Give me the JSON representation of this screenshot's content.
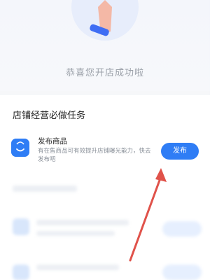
{
  "header": {
    "congrats_text": "恭喜您开店成功啦"
  },
  "section": {
    "title": "店铺经营必做任务"
  },
  "task": {
    "title": "发布商品",
    "description": "有在售商品可有效提升店铺曝光能力，快去发布吧",
    "button_label": "发布"
  },
  "colors": {
    "primary": "#2f7df5",
    "annotation_arrow": "#e0524a"
  },
  "icons": {
    "task_icon": "shopping-bag-icon"
  }
}
